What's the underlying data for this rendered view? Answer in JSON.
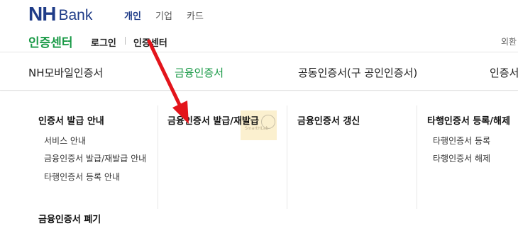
{
  "header": {
    "logo_nh": "NH",
    "logo_bank": "Bank",
    "segments": [
      "개인",
      "기업",
      "카드"
    ]
  },
  "breadcrumb": {
    "title": "인증센터",
    "items": [
      "로그인",
      "인증센터"
    ],
    "right_text": "외환"
  },
  "tabs": [
    {
      "label": "NH모바일인증서",
      "active": false
    },
    {
      "label": "금융인증서",
      "active": true
    },
    {
      "label": "공동인증서(구 공인인증서)",
      "active": false
    },
    {
      "label": "인증서",
      "active": false
    }
  ],
  "menu": {
    "col1": {
      "title": "인증서 발급 안내",
      "links": [
        "서비스 안내",
        "금융인증서 발급/재발급 안내",
        "타행인증서 등록 안내"
      ]
    },
    "col2": {
      "title": "금융인증서 발급/재발급"
    },
    "col3": {
      "title": "금융인증서 갱신"
    },
    "col4": {
      "title": "타행인증서 등록/해제",
      "links": [
        "타행인증서 등록",
        "타행인증서 해제"
      ]
    },
    "extra_title": "금융인증서 폐기"
  },
  "watermark": {
    "text": "SmartHLab"
  },
  "colors": {
    "brand_blue": "#1f3c88",
    "accent_green": "#1a9a47",
    "annotation_red": "#e3141b"
  }
}
